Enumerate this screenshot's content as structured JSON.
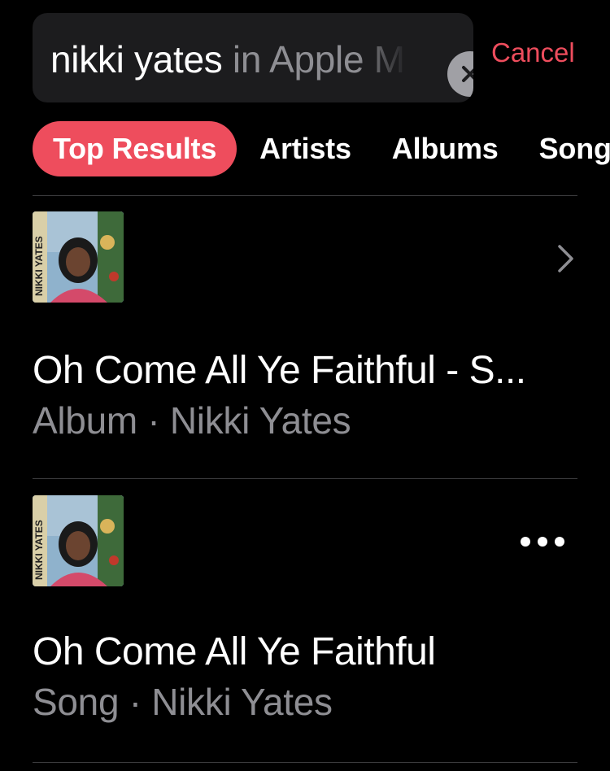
{
  "search": {
    "query": "nikki yates",
    "scope_suffix": " in Apple Music"
  },
  "header": {
    "cancel_label": "Cancel"
  },
  "tabs": [
    {
      "label": "Top Results",
      "active": true
    },
    {
      "label": "Artists",
      "active": false
    },
    {
      "label": "Albums",
      "active": false
    },
    {
      "label": "Songs",
      "active": false
    }
  ],
  "results": [
    {
      "title": "Oh Come All Ye Faithful - S...",
      "subtitle": "Album · Nikki Yates",
      "action_icon": "chevron-right-icon",
      "artwork_text": "NIKKI YATES"
    },
    {
      "title": "Oh Come All Ye Faithful",
      "subtitle": "Song · Nikki Yates",
      "action_icon": "more-icon",
      "artwork_text": "NIKKI YATES"
    }
  ],
  "colors": {
    "accent": "#ee4d5d",
    "background": "#000000",
    "secondary_text": "#8e8e93",
    "search_field": "#1c1c1e"
  }
}
